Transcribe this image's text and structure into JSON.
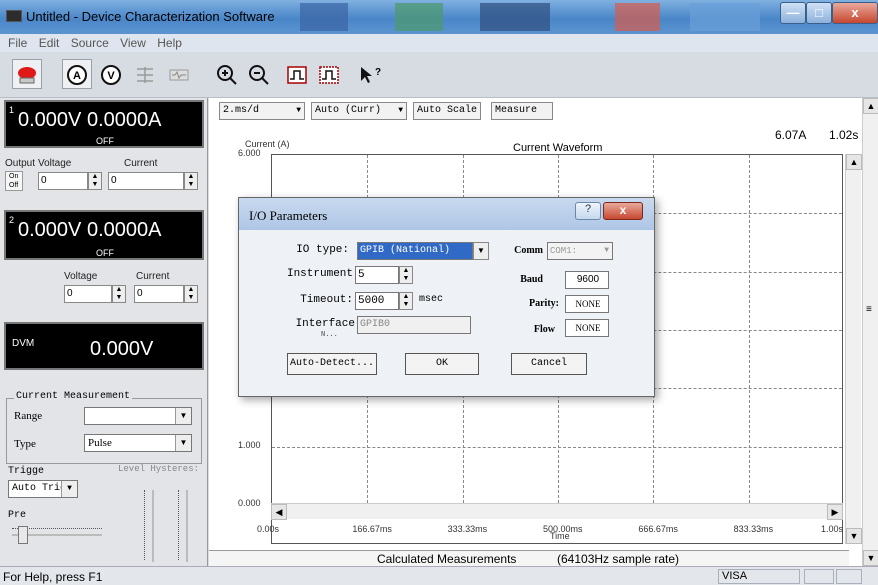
{
  "window": {
    "title": "Untitled - Device Characterization Software",
    "minimize": "—",
    "maximize": "□",
    "close": "x"
  },
  "menu": [
    "File",
    "Edit",
    "Source",
    "View",
    "Help"
  ],
  "toolbar": {
    "icons": [
      "stop-icon",
      "ammeter-icon",
      "voltmeter-icon",
      "signal-icon",
      "waveform-icon",
      "zoom-in-icon",
      "zoom-out-icon",
      "pulse-icon",
      "pulse-dashed-icon",
      "help-cursor-icon"
    ]
  },
  "channel1": {
    "index": "1",
    "display": "0.000V 0.0000A",
    "state": "OFF",
    "output_label": "Output",
    "on_label": "On",
    "off_label": "Off",
    "voltage_label": "Voltage",
    "current_label": "Current",
    "voltage_value": "0",
    "current_value": "0"
  },
  "channel2": {
    "index": "2",
    "display": "0.000V 0.0000A",
    "state": "OFF",
    "voltage_label": "Voltage",
    "current_label": "Current",
    "voltage_value": "0",
    "current_value": "0"
  },
  "dvm": {
    "label": "DVM",
    "value": "0.000V"
  },
  "current_measurement": {
    "group_label": "Current Measurement",
    "range_label": "Range",
    "range_value": "",
    "type_label": "Type",
    "type_value": "Pulse",
    "trigger_label": "Trigge",
    "level_label": "Level Hysteres:",
    "trigger_value": "Auto Trig",
    "pre_label": "Pre"
  },
  "plot_controls": {
    "timebase": "2.ms/d",
    "mode": "Auto (Curr)",
    "auto_scale": "Auto Scale",
    "measure": "Measure"
  },
  "chart_data": {
    "type": "line",
    "title": "Current Waveform",
    "ylabel": "Current (A)",
    "xlabel": "Time",
    "readout_current": "6.07A",
    "readout_time": "1.02s",
    "y_ticks": [
      "6.000",
      "1.000",
      "0.000"
    ],
    "x_ticks": [
      "0.00s",
      "166.67ms",
      "333.33ms",
      "500.00ms",
      "666.67ms",
      "833.33ms",
      "1.00s"
    ],
    "ylim": [
      0,
      6
    ],
    "xlim": [
      0,
      1
    ],
    "grid": true,
    "series": []
  },
  "calculated": {
    "label": "Calculated Measurements",
    "rate": "(64103Hz sample rate)"
  },
  "dialog": {
    "title": "I/O Parameters",
    "help": "?",
    "close": "x",
    "io_type_label": "IO type:",
    "io_type_value": "GPIB (National)",
    "instrument_label": "Instrument",
    "instrument_value": "5",
    "timeout_label": "Timeout:",
    "timeout_value": "5000",
    "timeout_unit": "msec",
    "interface_label": "Interface",
    "interface_label2": "N...",
    "interface_value": "GPIB0",
    "comm_label": "Comm",
    "comm_value": "COM1:",
    "baud_label": "Baud",
    "baud_value": "9600",
    "parity_label": "Parity:",
    "parity_value": "NONE",
    "flow_label": "Flow",
    "flow_value": "NONE",
    "auto_detect": "Auto-Detect...",
    "ok": "OK",
    "cancel": "Cancel"
  },
  "status": {
    "help_text": "For Help, press F1",
    "interface": "VISA"
  }
}
